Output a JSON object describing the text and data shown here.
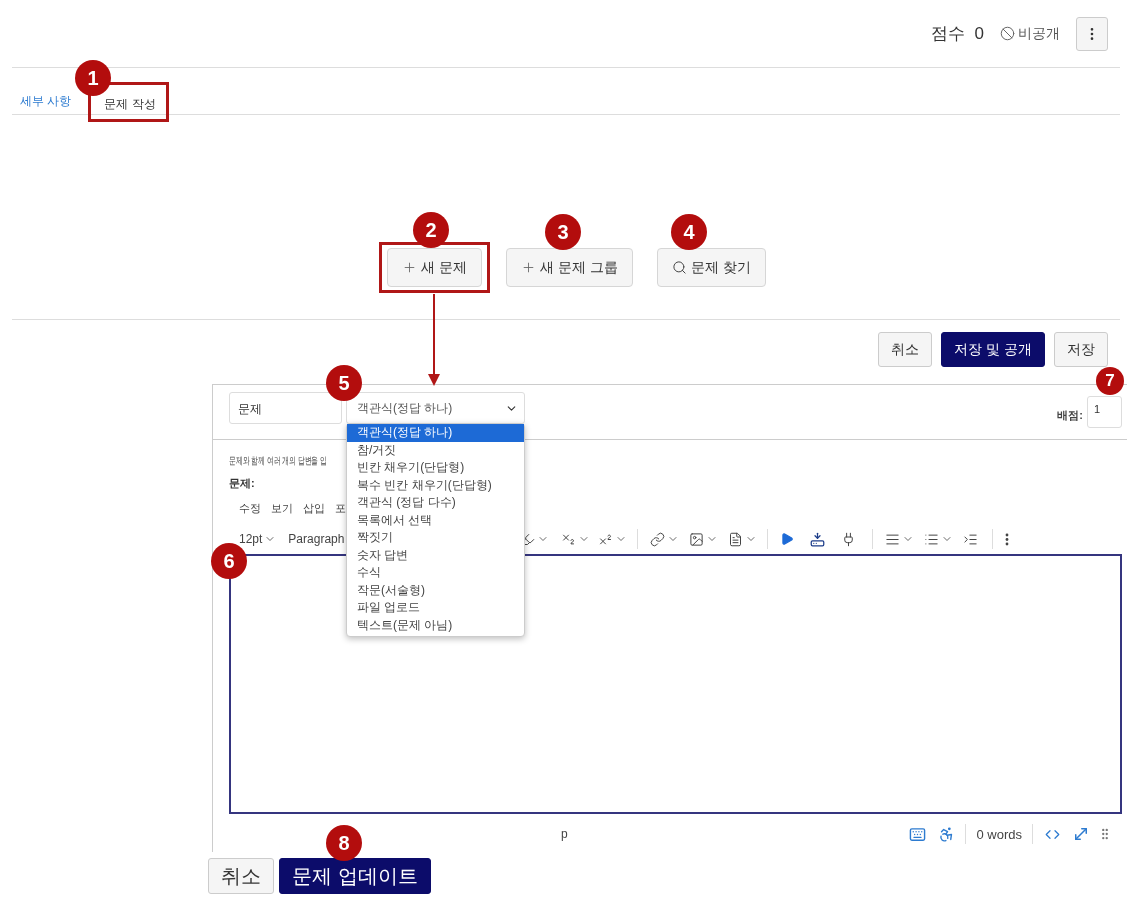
{
  "header": {
    "score_label": "점수",
    "score_value": "0",
    "visibility": "비공개"
  },
  "tabs": [
    {
      "label": "세부 사항",
      "selected": false
    },
    {
      "label": "문제 작성",
      "selected": true
    }
  ],
  "question_actions": [
    {
      "label": "새 문제",
      "kind": "add"
    },
    {
      "label": "새 문제 그룹",
      "kind": "add"
    },
    {
      "label": "문제 찾기",
      "kind": "search"
    }
  ],
  "form_actions": [
    {
      "label": "취소",
      "primary": false
    },
    {
      "label": "저장 및 공개",
      "primary": true
    },
    {
      "label": "저장",
      "primary": false
    }
  ],
  "question_form": {
    "name_value": "문제",
    "type_select": {
      "value": "객관식(정답 하나)",
      "expanded": true,
      "options": [
        {
          "label": "객관식(정답 하나)",
          "selected": true
        },
        {
          "label": "참/거짓",
          "selected": false
        },
        {
          "label": "빈칸 채우기(단답형)",
          "selected": false
        },
        {
          "label": "복수 빈칸 채우기(단답형)",
          "selected": false
        },
        {
          "label": "객관식 (정답 다수)",
          "selected": false
        },
        {
          "label": "목록에서 선택",
          "selected": false
        },
        {
          "label": "짝짓기",
          "selected": false
        },
        {
          "label": "숫자 답변",
          "selected": false
        },
        {
          "label": "수식",
          "selected": false
        },
        {
          "label": "작문(서술형)",
          "selected": false
        },
        {
          "label": "파일 업로드",
          "selected": false
        },
        {
          "label": "텍스트(문제 아님)",
          "selected": false
        }
      ]
    },
    "points_label": "배점:",
    "points_value": "1",
    "help_text": "문제와 함께 여러 개의 답변을 입",
    "question_label": "문제:",
    "menubar": [
      "수정",
      "보기",
      "삽입",
      "포"
    ],
    "font_size": "12pt",
    "block_format": "Paragraph",
    "status_bar": {
      "element_path": "p",
      "word_count": "0 words"
    }
  },
  "bottom_actions": [
    {
      "label": "취소",
      "primary": false
    },
    {
      "label": "문제 업데이트",
      "primary": true
    }
  ],
  "annotations": [
    {
      "label": "1"
    },
    {
      "label": "2"
    },
    {
      "label": "3"
    },
    {
      "label": "4"
    },
    {
      "label": "5"
    },
    {
      "label": "6"
    },
    {
      "label": "7"
    },
    {
      "label": "8"
    }
  ]
}
